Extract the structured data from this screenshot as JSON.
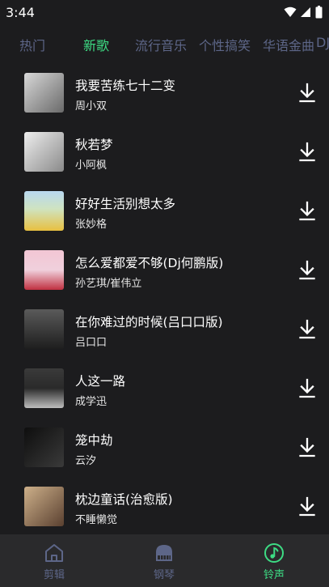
{
  "status_bar": {
    "time": "3:44"
  },
  "tabs": [
    {
      "label": "热门"
    },
    {
      "label": "新歌",
      "active": true
    },
    {
      "label": "流行音乐"
    },
    {
      "label": "个性搞笑"
    },
    {
      "label": "华语金曲"
    },
    {
      "label": "DJ"
    }
  ],
  "songs": [
    {
      "title": "我要苦练七十二变",
      "artist": "周小双",
      "cover_colors": [
        "#d8d8d8",
        "#6a6a6a"
      ]
    },
    {
      "title": "秋若梦",
      "artist": "小阿枫",
      "cover_colors": [
        "#eeeeee",
        "#8a8a8a"
      ]
    },
    {
      "title": "好好生活别想太多",
      "artist": "张妙格",
      "cover_colors": [
        "#b8d8f0",
        "#e8c040"
      ]
    },
    {
      "title": "怎么爱都爱不够(Dj何鹏版)",
      "artist": "孙艺琪/崔伟立",
      "cover_colors": [
        "#f2c6d4",
        "#c03040"
      ]
    },
    {
      "title": "在你难过的时候(吕口口版)",
      "artist": "吕口口",
      "cover_colors": [
        "#5a5a5a",
        "#1e1e1e"
      ]
    },
    {
      "title": "人这一路",
      "artist": "成学迅",
      "cover_colors": [
        "#3a3a3a",
        "#bdbdbd"
      ]
    },
    {
      "title": "笼中劫",
      "artist": "云汐",
      "cover_colors": [
        "#0e0e0e",
        "#3a3a3a"
      ]
    },
    {
      "title": "枕边童话(治愈版)",
      "artist": "不睡懒觉",
      "cover_colors": [
        "#cdb08a",
        "#5a4030"
      ]
    }
  ],
  "bottom_nav": [
    {
      "label": "剪辑",
      "icon": "home-icon"
    },
    {
      "label": "钢琴",
      "icon": "piano-icon"
    },
    {
      "label": "铃声",
      "icon": "music-note-icon",
      "active": true
    }
  ],
  "colors": {
    "accent": "#3ddc84",
    "inactive": "#5d6688",
    "background": "#1c1c1e",
    "nav_background": "#2a2a2c"
  }
}
